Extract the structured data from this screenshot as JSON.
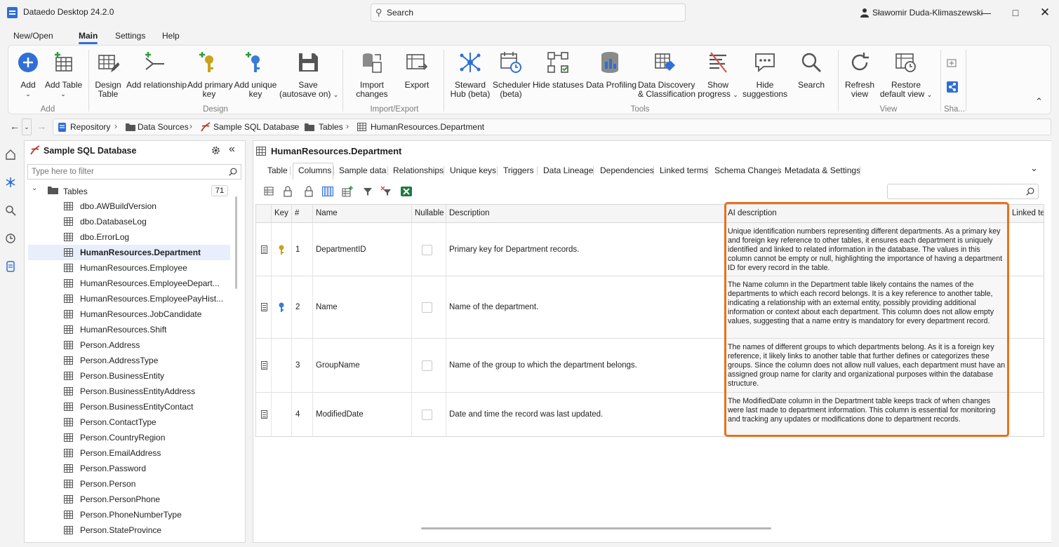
{
  "window": {
    "title": "Dataedo Desktop 24.2.0",
    "search_label": "Search",
    "user": "Sławomir Duda-Klimaszewski"
  },
  "menu": [
    "New/Open",
    "Main",
    "Settings",
    "Help"
  ],
  "ribbon": {
    "add": {
      "add": "Add",
      "add_table": "Add Table",
      "group": "Add"
    },
    "design": {
      "design_table_1": "Design",
      "design_table_2": "Table",
      "add_relationship": "Add relationship",
      "add_pk_1": "Add primary",
      "add_pk_2": "key",
      "add_uk_1": "Add unique",
      "add_uk_2": "key",
      "save_1": "Save",
      "save_2": "(autosave on)",
      "group": "Design"
    },
    "import_export": {
      "import_1": "Import",
      "import_2": "changes",
      "export": "Export",
      "group": "Import/Export"
    },
    "tools": {
      "steward_1": "Steward",
      "steward_2": "Hub (beta)",
      "scheduler_1": "Scheduler",
      "scheduler_2": "(beta)",
      "hide_statuses": "Hide statuses",
      "data_profiling": "Data Profiling",
      "discovery_1": "Data Discovery",
      "discovery_2": "& Classification",
      "show_progress_1": "Show",
      "show_progress_2": "progress",
      "hide_suggestions_1": "Hide",
      "hide_suggestions_2": "suggestions",
      "search": "Search",
      "group": "Tools"
    },
    "view": {
      "refresh_1": "Refresh",
      "refresh_2": "view",
      "restore_1": "Restore",
      "restore_2": "default view",
      "group": "View"
    },
    "share": {
      "group": "Sha..."
    }
  },
  "breadcrumb": [
    "Repository",
    "Data Sources",
    "Sample SQL Database",
    "Tables",
    "HumanResources.Department"
  ],
  "left_panel": {
    "title": "Sample SQL Database",
    "filter_placeholder": "Type here to filter",
    "folder_label": "Tables",
    "folder_count": "71",
    "tables": [
      "dbo.AWBuildVersion",
      "dbo.DatabaseLog",
      "dbo.ErrorLog",
      "HumanResources.Department",
      "HumanResources.Employee",
      "HumanResources.EmployeeDepart...",
      "HumanResources.EmployeePayHist...",
      "HumanResources.JobCandidate",
      "HumanResources.Shift",
      "Person.Address",
      "Person.AddressType",
      "Person.BusinessEntity",
      "Person.BusinessEntityAddress",
      "Person.BusinessEntityContact",
      "Person.ContactType",
      "Person.CountryRegion",
      "Person.EmailAddress",
      "Person.Password",
      "Person.Person",
      "Person.PersonPhone",
      "Person.PhoneNumberType",
      "Person.StateProvince"
    ],
    "selected_index": 3
  },
  "object": {
    "title": "HumanResources.Department",
    "tabs": [
      "Table",
      "Columns",
      "Sample data",
      "Relationships",
      "Unique keys",
      "Triggers",
      "Data Lineage",
      "Dependencies",
      "Linked terms",
      "Schema Changes",
      "Metadata & Settings"
    ],
    "active_tab": "Columns"
  },
  "grid": {
    "headers": {
      "key": "Key",
      "num": "#",
      "name": "Name",
      "nullable": "Nullable",
      "description": "Description",
      "ai": "AI description",
      "linked": "Linked ter"
    },
    "rows": [
      {
        "num": "1",
        "name": "DepartmentID",
        "key": "primary",
        "nullable": false,
        "description": "Primary key for Department records.",
        "ai": "Unique identification numbers representing different departments. As a primary key and foreign key reference to other tables, it ensures each department is uniquely identified and linked to related information in the database. The values in this column cannot be empty or null, highlighting the importance of having a department ID for every record in the table."
      },
      {
        "num": "2",
        "name": "Name",
        "key": "unique",
        "nullable": false,
        "description": "Name of the department.",
        "ai": "The Name column in the Department table likely contains the names of the departments to which each record belongs. It is a key reference to another table, indicating a relationship with an external entity, possibly providing additional information or context about each department. This column does not allow empty values, suggesting that a name entry is mandatory for every department record."
      },
      {
        "num": "3",
        "name": "GroupName",
        "key": "",
        "nullable": false,
        "description": "Name of the group to which the department belongs.",
        "ai": "The names of different groups to which departments belong. As it is a foreign key reference, it likely links to another table that further defines or categorizes these groups. Since the column does not allow null values, each department must have an assigned group name for clarity and organizational purposes within the database structure."
      },
      {
        "num": "4",
        "name": "ModifiedDate",
        "key": "",
        "nullable": false,
        "description": "Date and time the record was last updated.",
        "ai": "The ModifiedDate column in the Department table keeps track of when changes were last made to department information. This column is essential for monitoring and tracking any updates or modifications done to department records."
      }
    ]
  },
  "colors": {
    "accent": "#2f6fd6",
    "highlight": "#e8701e",
    "key_primary": "#c9a31c",
    "key_unique": "#3a7bd5"
  }
}
